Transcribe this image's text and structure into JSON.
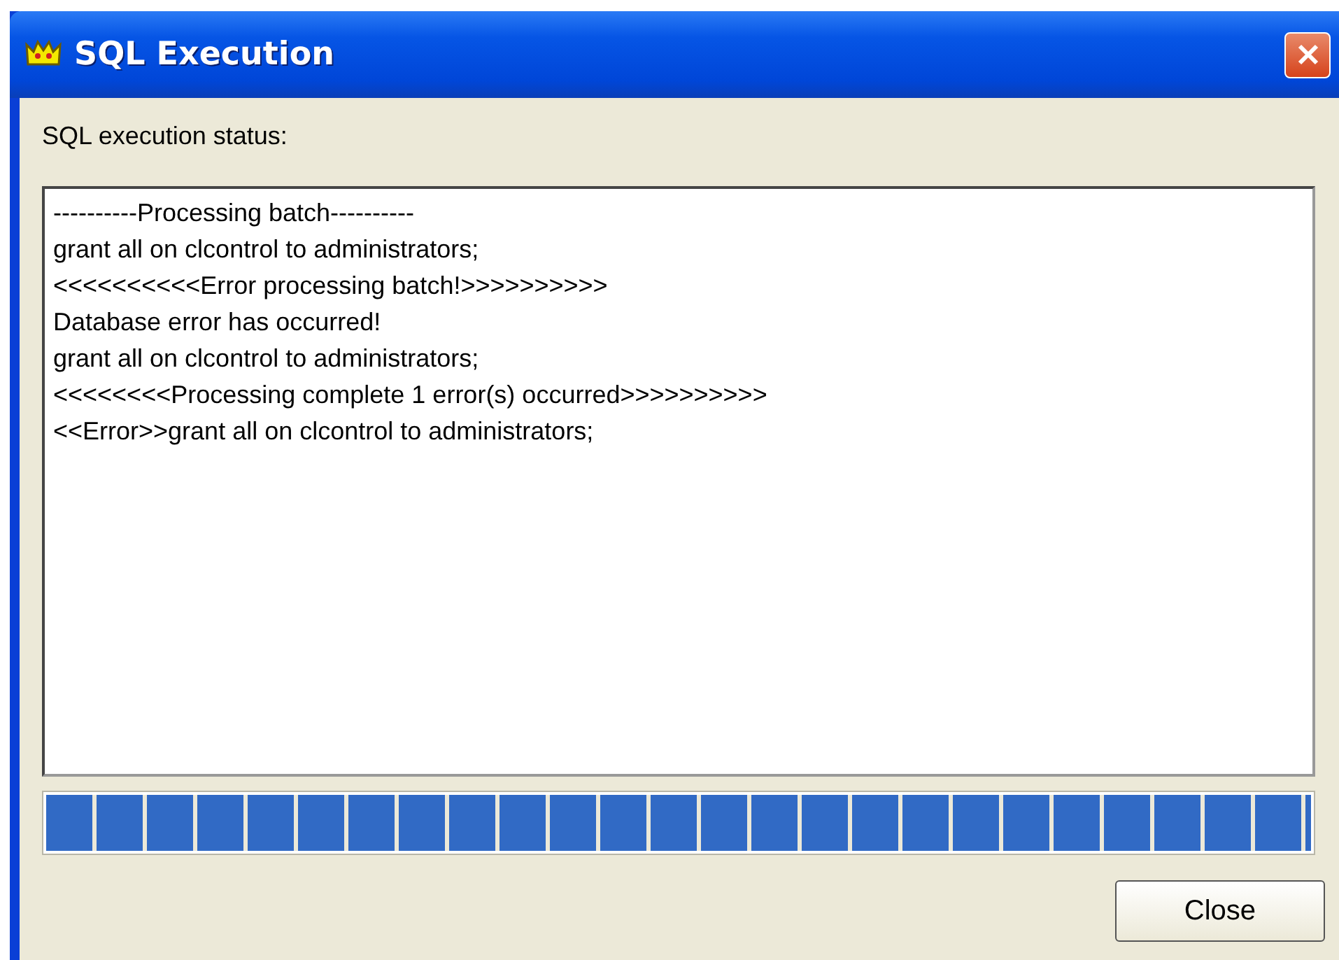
{
  "window": {
    "title": "SQL Execution"
  },
  "status_label": "SQL execution status:",
  "log_lines": [
    "----------Processing batch----------",
    "grant all on clcontrol to administrators;",
    "<<<<<<<<<<Error processing batch!>>>>>>>>>>",
    "Database error has occurred!",
    "grant all on clcontrol to administrators;",
    "<<<<<<<<Processing complete 1 error(s) occurred>>>>>>>>>>",
    "<<Error>>grant all on clcontrol to administrators;"
  ],
  "progress": {
    "level": 1
  },
  "buttons": [
    {
      "label": "Close"
    }
  ]
}
